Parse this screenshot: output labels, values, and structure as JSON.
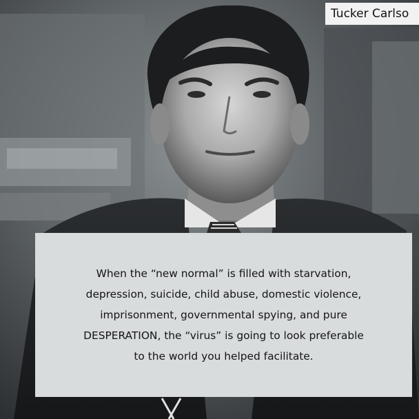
{
  "badge": {
    "text": "Tucker Carlso"
  },
  "quote": {
    "lines": [
      "When the “new normal” is filled with starvation,",
      "depression, suicide, child abuse, domestic violence,",
      "imprisonment, governmental spying, and pure",
      "DESPERATION, the “virus” is going to look preferable",
      "to the world you helped facilitate."
    ]
  },
  "photo": {
    "subject": "man-in-suit-portrait",
    "tone": "black-and-white"
  }
}
